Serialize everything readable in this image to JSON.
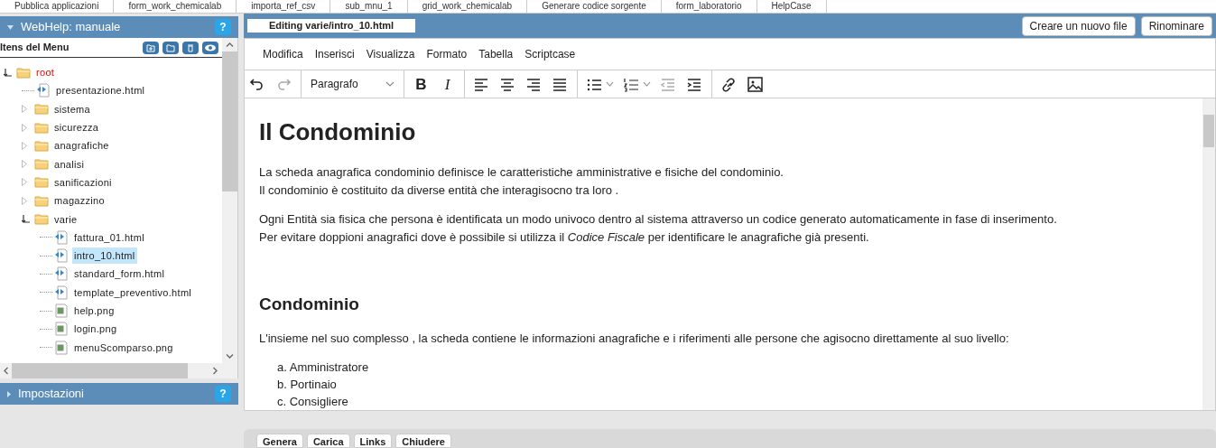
{
  "top_tabs": [
    "Pubblica applicazioni",
    "form_work_chemicalab",
    "importa_ref_csv",
    "sub_mnu_1",
    "grid_work_chemicalab",
    "Generare codice sorgente",
    "form_laboratorio",
    "HelpCase"
  ],
  "left_panel": {
    "title": "WebHelp: manuale",
    "help": "?",
    "menu_title": "Itens del Menu",
    "tree": [
      {
        "label": "root",
        "kind": "folder",
        "expanded": true,
        "selected": false,
        "children": [
          {
            "label": "presentazione.html",
            "kind": "html",
            "selected": false
          },
          {
            "label": "sistema",
            "kind": "folder",
            "expanded": false,
            "selected": false
          },
          {
            "label": "sicurezza",
            "kind": "folder",
            "expanded": false,
            "selected": false
          },
          {
            "label": "anagrafiche",
            "kind": "folder",
            "expanded": false,
            "selected": false
          },
          {
            "label": "analisi",
            "kind": "folder",
            "expanded": false,
            "selected": false
          },
          {
            "label": "sanificazioni",
            "kind": "folder",
            "expanded": false,
            "selected": false
          },
          {
            "label": "magazzino",
            "kind": "folder",
            "expanded": false,
            "selected": false
          },
          {
            "label": "varie",
            "kind": "folder",
            "expanded": true,
            "selected": false,
            "children": [
              {
                "label": "fattura_01.html",
                "kind": "html",
                "selected": false
              },
              {
                "label": "intro_10.html",
                "kind": "html",
                "selected": true
              },
              {
                "label": "standard_form.html",
                "kind": "html",
                "selected": false
              },
              {
                "label": "template_preventivo.html",
                "kind": "html",
                "selected": false
              },
              {
                "label": "help.png",
                "kind": "png",
                "selected": false
              },
              {
                "label": "login.png",
                "kind": "png",
                "selected": false
              },
              {
                "label": "menuScomparso.png",
                "kind": "png",
                "selected": false
              }
            ]
          }
        ]
      }
    ],
    "settings": {
      "title": "Impostazioni",
      "help": "?"
    }
  },
  "editor": {
    "tab": "Editing varie/intro_10.html",
    "buttons": [
      "Creare un nuovo file",
      "Rinominare"
    ],
    "menu": [
      "Modifica",
      "Inserisci",
      "Visualizza",
      "Formato",
      "Tabella",
      "Scriptcase"
    ],
    "toolbar": [
      {
        "kind": "undo",
        "disabled": false
      },
      {
        "kind": "redo",
        "disabled": true
      },
      {
        "kind": "sep"
      },
      {
        "kind": "select",
        "label": "Paragrafo"
      },
      {
        "kind": "sep"
      },
      {
        "kind": "text",
        "label": "B",
        "disabled": false
      },
      {
        "kind": "italic",
        "label": "I",
        "disabled": false
      },
      {
        "kind": "sep"
      },
      {
        "kind": "align-left",
        "disabled": false
      },
      {
        "kind": "align-center",
        "disabled": false
      },
      {
        "kind": "align-right",
        "disabled": false
      },
      {
        "kind": "justify",
        "disabled": false
      },
      {
        "kind": "sep"
      },
      {
        "kind": "bullets",
        "disabled": false
      },
      {
        "kind": "numbers",
        "disabled": false
      },
      {
        "kind": "outdent",
        "disabled": true
      },
      {
        "kind": "indent",
        "disabled": false
      },
      {
        "kind": "sep"
      },
      {
        "kind": "link",
        "disabled": false
      },
      {
        "kind": "image",
        "disabled": false
      }
    ],
    "content": [
      {
        "kind": "h1",
        "text": "Il Condominio"
      },
      {
        "kind": "p",
        "lines": [
          "La scheda anagrafica condominio definisce le caratteristiche amministrative e fisiche del condominio.",
          "Il condominio è costituito da diverse entità che interagisocno tra loro ."
        ]
      },
      {
        "kind": "p",
        "lines": [
          "Ogni Entità sia fisica che persona è identificata un modo univoco dentro al sistema attraverso un codice generato automaticamente in fase di inserimento.",
          "Per evitare doppioni anagrafici dove è possibile si utilizza il *Codice Fiscale* per identificare le anagrafiche già presenti."
        ]
      },
      {
        "kind": "h2",
        "text": "Condominio"
      },
      {
        "kind": "p",
        "lines": [
          "L'insieme nel suo complesso , la scheda contiene le informazioni anagrafiche e i riferimenti alle persone che agisocno direttamente al suo livello:"
        ]
      },
      {
        "kind": "ol",
        "items": [
          "a. Amministratore",
          "b. Portinaio",
          "c. Consigliere"
        ]
      }
    ]
  },
  "bottom_buttons": [
    "Genera",
    "Carica",
    "Links",
    "Chiudere"
  ]
}
